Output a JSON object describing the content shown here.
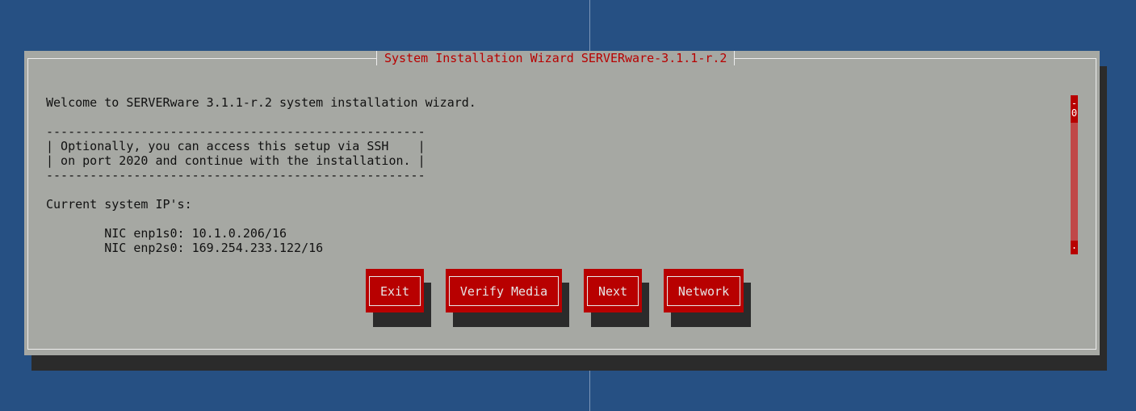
{
  "dialog": {
    "title": "System Installation Wizard SERVERware-3.1.1-r.2",
    "lines": [
      "Welcome to SERVERware 3.1.1-r.2 system installation wizard.",
      "",
      "----------------------------------------------------",
      "| Optionally, you can access this setup via SSH    |",
      "| on port 2020 and continue with the installation. |",
      "----------------------------------------------------",
      "",
      "Current system IP's:",
      "",
      "        NIC enp1s0: 10.1.0.206/16",
      "        NIC enp2s0: 169.254.233.122/16"
    ]
  },
  "scrollbar": {
    "top_label": "-\n0",
    "bottom_label": "."
  },
  "buttons": {
    "exit": "Exit",
    "verify_media": "Verify Media",
    "next": "Next",
    "network": "Network"
  },
  "colors": {
    "background": "#265083",
    "dialog": "#a6a8a3",
    "accent": "#b80000"
  }
}
